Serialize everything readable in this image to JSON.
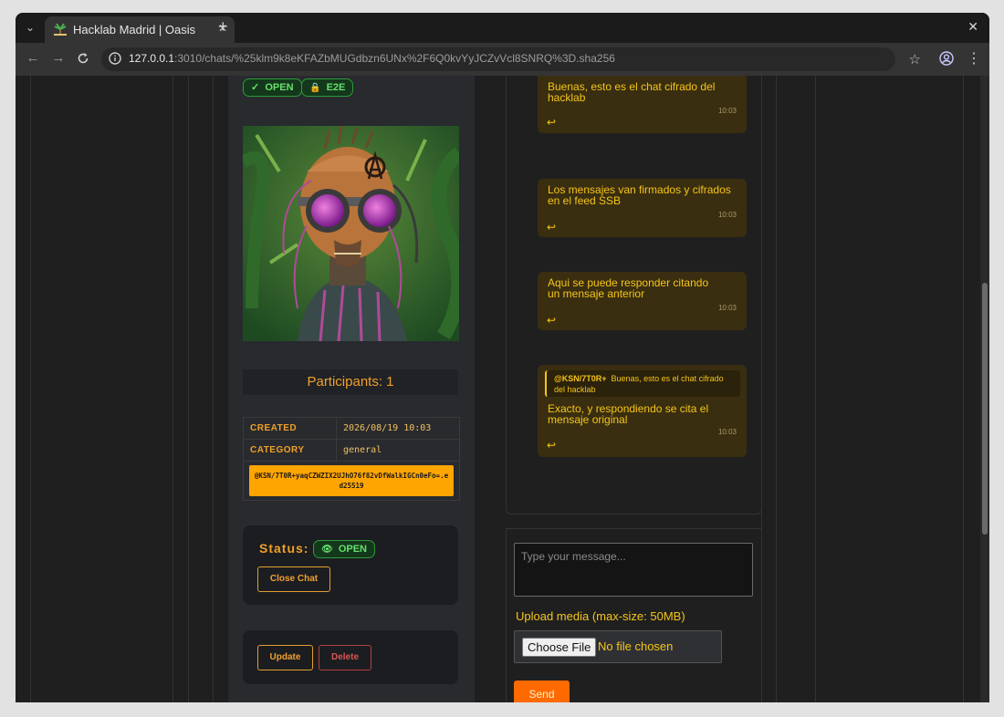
{
  "browser": {
    "tab_title": "Hacklab Madrid | Oasis",
    "url_host": "127.0.0.1",
    "url_rest": ":3010/chats/%25klm9k8eKFAZbMUGdbzn6UNx%2F6Q0kvYyJCZvVcl8SNRQ%3D.sha256",
    "new_tab": "+",
    "close_window": "✕",
    "close_tab": "✕",
    "tab_menu": "⌄"
  },
  "badges": {
    "open_icon": "✓",
    "open": "OPEN",
    "e2e_icon": "🔒",
    "e2e": "E2E"
  },
  "avatar": {
    "icon": "cyberpunk-avatar-image"
  },
  "participants": "Participants: 1",
  "meta": {
    "created_label": "CREATED",
    "created_value": "2026/08/19 10:03",
    "category_label": "CATEGORY",
    "category_value": "general",
    "author": "@KSN/7T0R+yaqCZWZIX2UJhO76f82vDfWalkIGCn0eFo=.ed25519"
  },
  "status": {
    "label": "Status:",
    "badge_icon": "👁",
    "badge_text": "OPEN",
    "close_button": "Close Chat"
  },
  "actions": {
    "update": "Update",
    "delete": "Delete"
  },
  "messages": [
    {
      "text": "Buenas, esto es el chat cifrado del hacklab",
      "time": "10:03",
      "reply": "↩"
    },
    {
      "text": "Los mensajes van firmados y cifrados en el feed SSB",
      "time": "10:03",
      "reply": "↩"
    },
    {
      "text": "Aqui se puede responder citando un mensaje anterior",
      "time": "10:03",
      "reply": "↩"
    },
    {
      "quote_author": "@KSN/7T0R+",
      "quote_text": "Buenas, esto es el chat cifrado del hacklab",
      "text": "Exacto, y respondiendo se cita el mensaje original",
      "time": "10:03",
      "reply": "↩"
    }
  ],
  "form": {
    "placeholder": "Type your message...",
    "upload_label": "Upload media (max-size: 50MB)",
    "choose_file": "Choose File",
    "no_file": "No file chosen",
    "send": "Send"
  }
}
